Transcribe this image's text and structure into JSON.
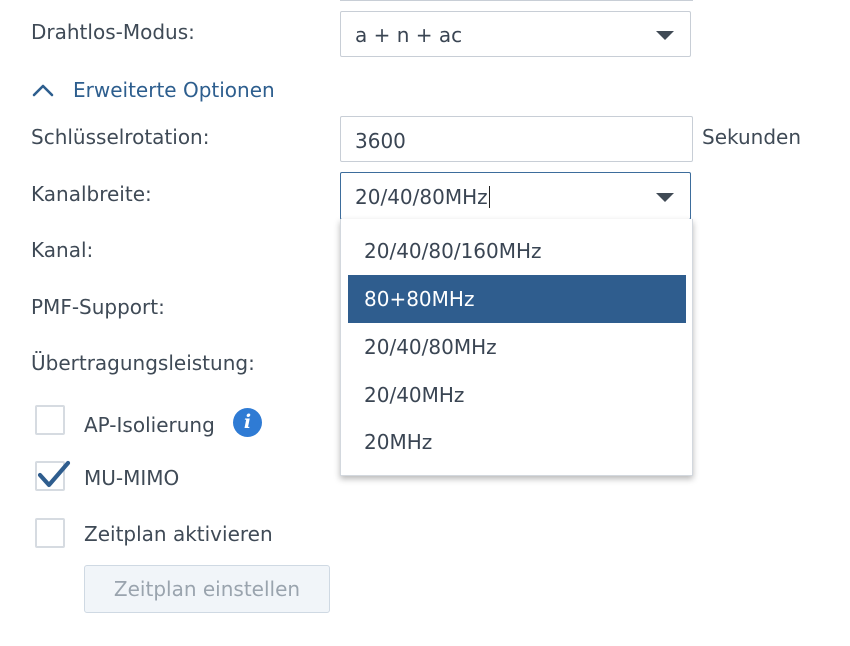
{
  "wireless_mode": {
    "label": "Drahtlos-Modus:",
    "value": "a + n + ac"
  },
  "advanced_toggle": {
    "label": "Erweiterte Optionen",
    "expanded": true
  },
  "key_rotation": {
    "label": "Schlüsselrotation:",
    "value": "3600",
    "unit": "Sekunden"
  },
  "channel_width": {
    "label": "Kanalbreite:",
    "value": "20/40/80MHz",
    "options": [
      "20/40/80/160MHz",
      "80+80MHz",
      "20/40/80MHz",
      "20/40MHz",
      "20MHz"
    ],
    "highlighted_option": "80+80MHz"
  },
  "channel": {
    "label": "Kanal:"
  },
  "pmf_support": {
    "label": "PMF-Support:"
  },
  "tx_power": {
    "label": "Übertragungsleistung:"
  },
  "ap_isolation": {
    "label": "AP-Isolierung",
    "checked": false,
    "info_icon": "i"
  },
  "mu_mimo": {
    "label": "MU-MIMO",
    "checked": true
  },
  "schedule_enable": {
    "label": "Zeitplan aktivieren",
    "checked": false
  },
  "schedule_button": {
    "label": "Zeitplan einstellen",
    "disabled": true
  },
  "colors": {
    "accent": "#2f5d8e",
    "link": "#2d5e8e",
    "info_icon": "#2f7bd4",
    "text": "#3f4a56",
    "border": "#c8ced6"
  }
}
